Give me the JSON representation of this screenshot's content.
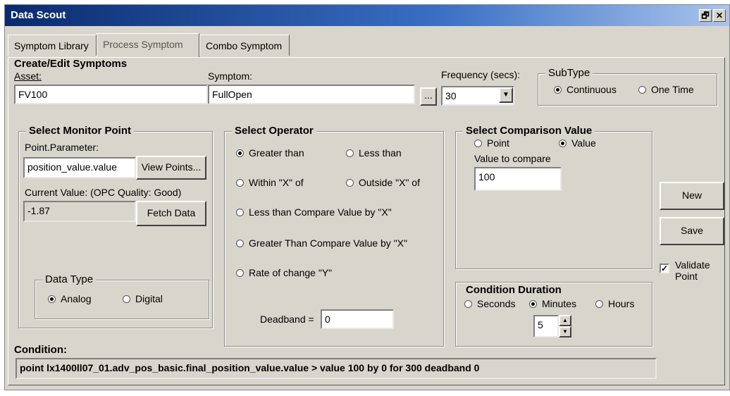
{
  "window": {
    "title": "Data Scout",
    "restore_glyph": "🗗",
    "close_glyph": "✕"
  },
  "tabs": [
    {
      "label": "Symptom Library"
    },
    {
      "label": "Process Symptom"
    },
    {
      "label": "Combo Symptom"
    }
  ],
  "create_edit": {
    "title": "Create/Edit Symptoms",
    "asset_label": "Asset:",
    "asset_value": "FV100",
    "symptom_label": "Symptom:",
    "symptom_value": "FullOpen",
    "browse_label": "...",
    "frequency_label": "Frequency (secs):",
    "frequency_value": "30",
    "subtype_title": "SubType",
    "subtype_options": [
      "Continuous",
      "One Time"
    ],
    "subtype_selected": "Continuous"
  },
  "monitor_point": {
    "title": "Select Monitor Point",
    "point_param_label": "Point.Parameter:",
    "point_param_value": "position_value.value",
    "view_points_label": "View Points...",
    "current_value_label": "Current Value: (OPC Quality: Good)",
    "current_value": "-1.87",
    "fetch_label": "Fetch Data",
    "data_type_title": "Data Type",
    "data_type_options": [
      "Analog",
      "Digital"
    ],
    "data_type_selected": "Analog"
  },
  "operator": {
    "title": "Select  Operator",
    "options": [
      "Greater than",
      "Less than",
      "Within \"X\" of",
      "Outside \"X\" of",
      "Less than Compare Value by \"X\"",
      "Greater Than Compare Value by \"X\"",
      "Rate of change \"Y\""
    ],
    "selected": "Greater than",
    "deadband_label": "Deadband =",
    "deadband_value": "0"
  },
  "comparison": {
    "title": "Select Comparison Value",
    "options": [
      "Point",
      "Value"
    ],
    "selected": "Value",
    "value_label": "Value to compare",
    "value": "100"
  },
  "duration": {
    "title": "Condition Duration",
    "options": [
      "Seconds",
      "Minutes",
      "Hours"
    ],
    "selected": "Minutes",
    "value": "5"
  },
  "actions": {
    "new_label": "New",
    "save_label": "Save",
    "validate_label": "Validate Point",
    "validate_checked": true
  },
  "condition": {
    "label": "Condition:",
    "text": "point lx1400ll07_01.adv_pos_basic.final_position_value.value > value 100 by 0 for 300 deadband 0"
  }
}
